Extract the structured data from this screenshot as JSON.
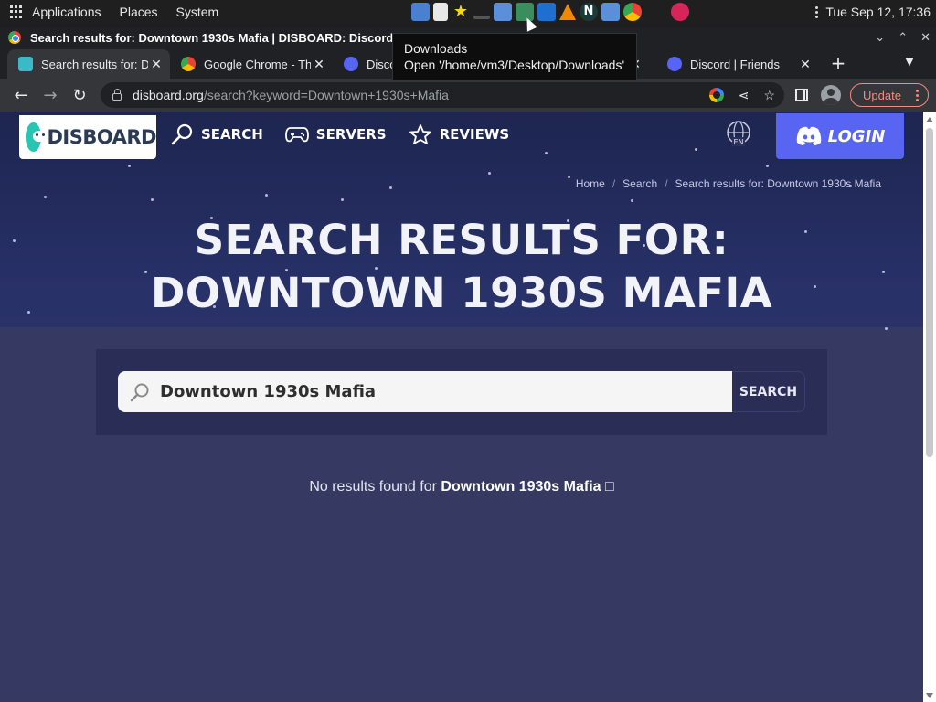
{
  "os_panel": {
    "menus": [
      "Applications",
      "Places",
      "System"
    ],
    "clock": "Tue Sep 12, 17:36"
  },
  "window": {
    "title": "Search results for: Downtown 1930s Mafia | DISBOARD: Discord Server List - Google Chrome"
  },
  "tabs": [
    {
      "label": "Search results for: Downtown",
      "favicon": "disboard-favicon",
      "active": true
    },
    {
      "label": "Google Chrome - Th",
      "favicon": "chrome-favicon",
      "active": false
    },
    {
      "label": "Disco",
      "favicon": "discord-favicon",
      "active": false
    },
    {
      "label": "Discord | Friends",
      "favicon": "discord-favicon",
      "active": false
    }
  ],
  "omnibox": {
    "host": "disboard.org",
    "path": "/search?keyword=Downtown+1930s+Mafia"
  },
  "toolbar": {
    "update_label": "Update"
  },
  "tooltip": {
    "line1": "Downloads",
    "line2": "Open '/home/vm3/Desktop/Downloads'"
  },
  "site": {
    "logo_text": "DISBOARD",
    "nav": {
      "search": "SEARCH",
      "servers": "SERVERS",
      "reviews": "REVIEWS"
    },
    "lang": "EN",
    "login_label": "LOGIN",
    "breadcrumb": {
      "home": "Home",
      "search": "Search",
      "current": "Search results for: Downtown 1930s Mafia"
    },
    "page_title": "Search results for: Downtown 1930s Mafia",
    "search": {
      "value": "Downtown 1930s Mafia",
      "submit_label": "SEARCH"
    },
    "no_results": {
      "prefix": "No results found for",
      "keyword": "Downtown 1930s Mafia",
      "suffix": "□"
    }
  },
  "colors": {
    "accent_discord": "#5865f2",
    "update_red": "#f28b82",
    "page_bg": "#2f3566"
  }
}
